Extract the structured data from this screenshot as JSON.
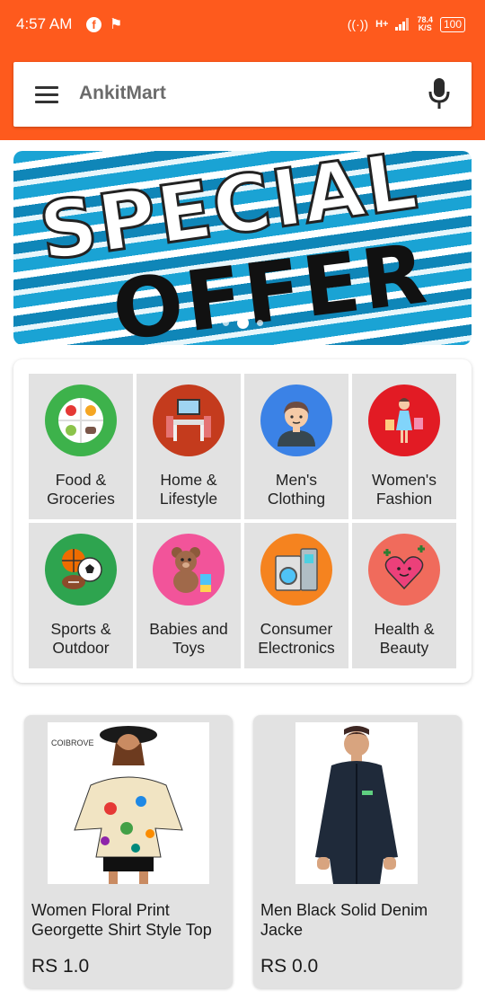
{
  "status_bar": {
    "time": "4:57 AM",
    "network": "H+",
    "speed_value": "78.4",
    "speed_unit": "K/S",
    "battery": "100"
  },
  "header": {
    "app_title": "AnkitMart",
    "menu_icon": "hamburger-menu-icon",
    "mic_icon": "microphone-icon"
  },
  "banner": {
    "line1": "SPECIAL",
    "line2": "OFFER"
  },
  "categories": [
    {
      "label": "Food &\nGroceries",
      "icon": "food-plate-icon",
      "color": "#3db24b"
    },
    {
      "label": "Home &\nLifestyle",
      "icon": "dining-room-icon",
      "color": "#c43b1d"
    },
    {
      "label": "Men's\nClothing",
      "icon": "man-avatar-icon",
      "color": "#3b82e6"
    },
    {
      "label": "Women's\nFashion",
      "icon": "woman-shopping-icon",
      "color": "#e21b24"
    },
    {
      "label": "Sports &\nOutdoor",
      "icon": "sports-balls-icon",
      "color": "#2ea44f"
    },
    {
      "label": "Babies and\nToys",
      "icon": "teddy-bear-icon",
      "color": "#f2549a"
    },
    {
      "label": "Consumer\nElectronics",
      "icon": "appliances-icon",
      "color": "#f5831f"
    },
    {
      "label": "Health &\nBeauty",
      "icon": "heart-muscle-icon",
      "color": "#f06b5c"
    }
  ],
  "products": [
    {
      "name": "Women  Floral Print Georgette Shirt Style Top",
      "price": "RS 1.0",
      "brand": "COIBROVE"
    },
    {
      "name": "Men Black Solid Denim Jacke",
      "price": "RS 0.0"
    }
  ],
  "colors": {
    "accent": "#fe5a1d"
  }
}
